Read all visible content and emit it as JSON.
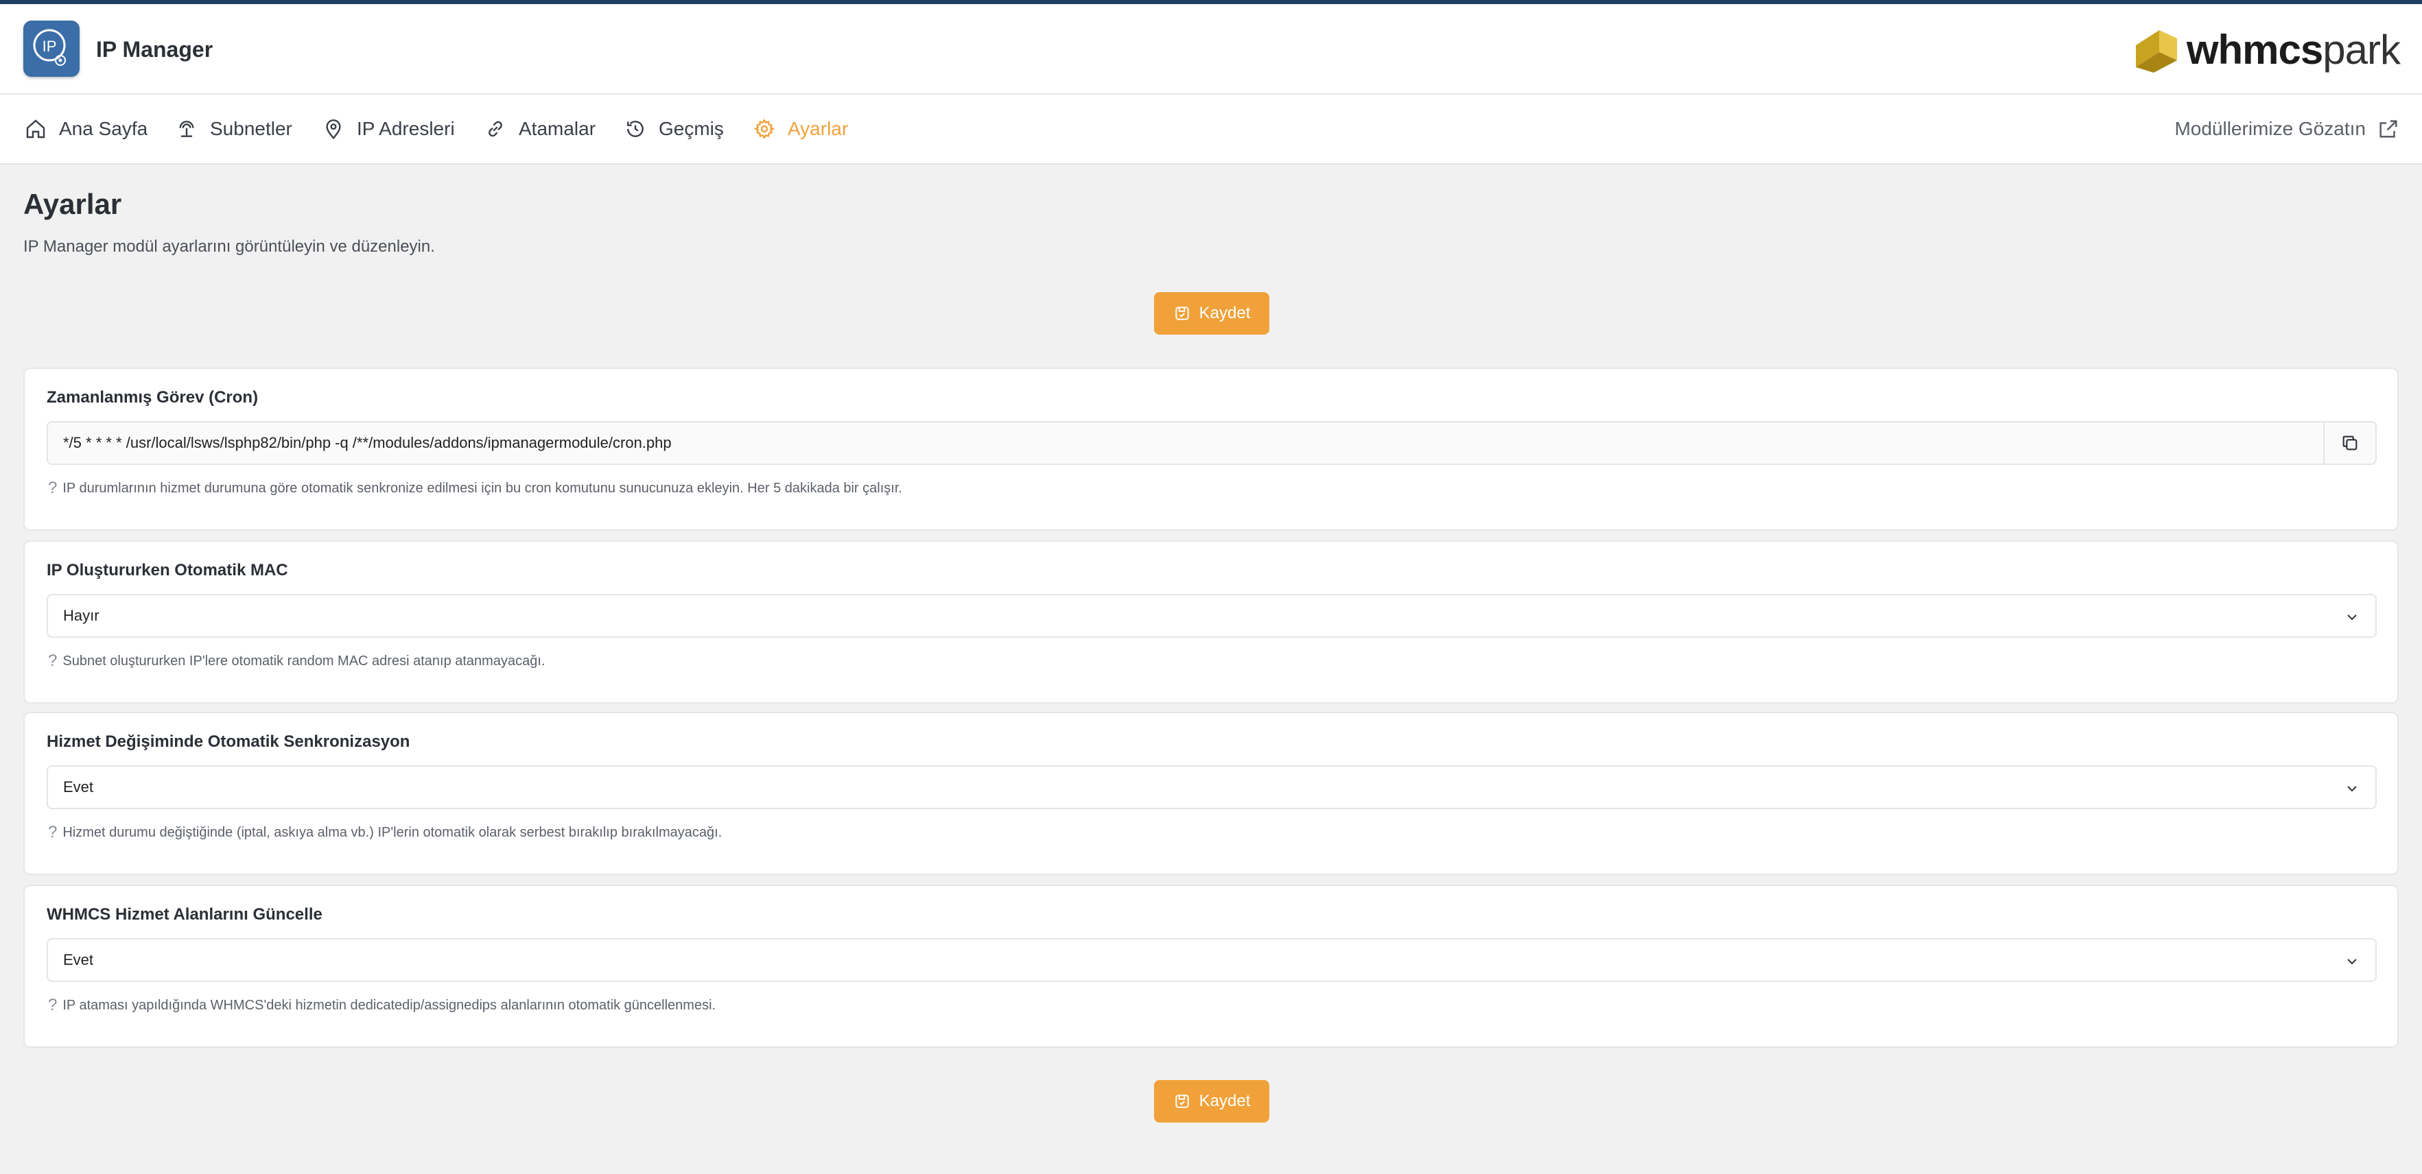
{
  "app": {
    "title": "IP Manager",
    "logo_text": "IP",
    "brand_bold": "whmcs",
    "brand_light": "park",
    "accent_color": "#f0a13a",
    "brand_color": "#3b6ea8"
  },
  "nav": {
    "items": [
      {
        "label": "Ana Sayfa",
        "icon": "home-icon"
      },
      {
        "label": "Subnetler",
        "icon": "network-icon"
      },
      {
        "label": "IP Adresleri",
        "icon": "location-pin-icon"
      },
      {
        "label": "Atamalar",
        "icon": "link-icon"
      },
      {
        "label": "Geçmiş",
        "icon": "history-icon"
      },
      {
        "label": "Ayarlar",
        "icon": "gear-icon",
        "active": true
      }
    ],
    "external_link": "Modüllerimize Gözatın"
  },
  "page": {
    "title": "Ayarlar",
    "subtitle": "IP Manager modül ayarlarını görüntüleyin ve düzenleyin."
  },
  "save_label": "Kaydet",
  "settings": [
    {
      "title": "Zamanlanmış Görev (Cron)",
      "value": "*/5 * * * * /usr/local/lsws/lsphp82/bin/php -q /**/modules/addons/ipmanagermodule/cron.php",
      "hint": "IP durumlarının hizmet durumuna göre otomatik senkronize edilmesi için bu cron komutunu sunucunuza ekleyin. Her 5 dakikada bir çalışır."
    },
    {
      "title": "IP Oluştururken Otomatik MAC",
      "value": "Hayır",
      "hint": "Subnet oluştururken IP'lere otomatik random MAC adresi atanıp atanmayacağı."
    },
    {
      "title": "Hizmet Değişiminde Otomatik Senkronizasyon",
      "value": "Evet",
      "hint": "Hizmet durumu değiştiğinde (iptal, askıya alma vb.) IP'lerin otomatik olarak serbest bırakılıp bırakılmayacağı."
    },
    {
      "title": "WHMCS Hizmet Alanlarını Güncelle",
      "value": "Evet",
      "hint": "IP ataması yapıldığında WHMCS'deki hizmetin dedicatedip/assignedips alanlarının otomatik güncellenmesi."
    }
  ]
}
